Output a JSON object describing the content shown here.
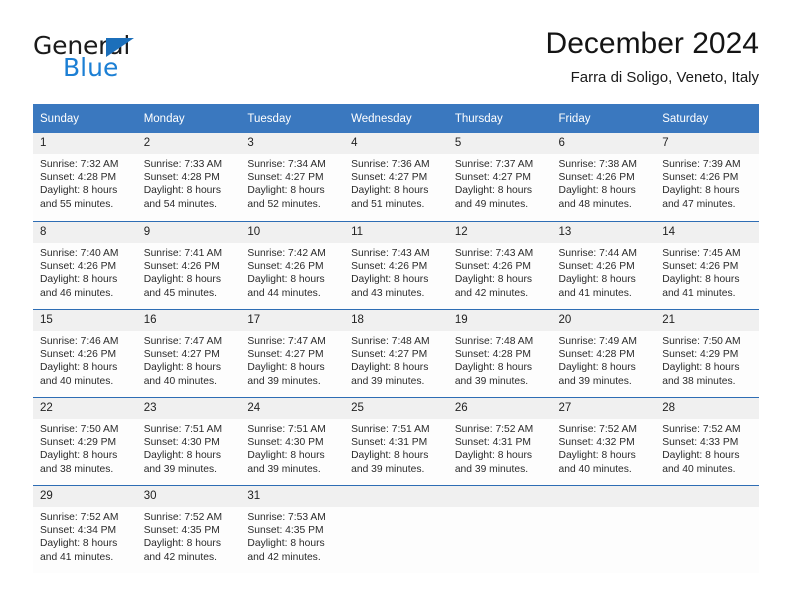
{
  "brand": {
    "line1": "General",
    "line2": "Blue",
    "accent_color": "#1c7fd4",
    "triangle_color": "#1c6fba"
  },
  "header": {
    "title": "December 2024",
    "subtitle": "Farra di Soligo, Veneto, Italy"
  },
  "calendar": {
    "header_color": "#3a78bf",
    "weekdays": [
      "Sunday",
      "Monday",
      "Tuesday",
      "Wednesday",
      "Thursday",
      "Friday",
      "Saturday"
    ],
    "weeks": [
      [
        {
          "day": "1",
          "sunrise": "Sunrise: 7:32 AM",
          "sunset": "Sunset: 4:28 PM",
          "daylight1": "Daylight: 8 hours",
          "daylight2": "and 55 minutes."
        },
        {
          "day": "2",
          "sunrise": "Sunrise: 7:33 AM",
          "sunset": "Sunset: 4:28 PM",
          "daylight1": "Daylight: 8 hours",
          "daylight2": "and 54 minutes."
        },
        {
          "day": "3",
          "sunrise": "Sunrise: 7:34 AM",
          "sunset": "Sunset: 4:27 PM",
          "daylight1": "Daylight: 8 hours",
          "daylight2": "and 52 minutes."
        },
        {
          "day": "4",
          "sunrise": "Sunrise: 7:36 AM",
          "sunset": "Sunset: 4:27 PM",
          "daylight1": "Daylight: 8 hours",
          "daylight2": "and 51 minutes."
        },
        {
          "day": "5",
          "sunrise": "Sunrise: 7:37 AM",
          "sunset": "Sunset: 4:27 PM",
          "daylight1": "Daylight: 8 hours",
          "daylight2": "and 49 minutes."
        },
        {
          "day": "6",
          "sunrise": "Sunrise: 7:38 AM",
          "sunset": "Sunset: 4:26 PM",
          "daylight1": "Daylight: 8 hours",
          "daylight2": "and 48 minutes."
        },
        {
          "day": "7",
          "sunrise": "Sunrise: 7:39 AM",
          "sunset": "Sunset: 4:26 PM",
          "daylight1": "Daylight: 8 hours",
          "daylight2": "and 47 minutes."
        }
      ],
      [
        {
          "day": "8",
          "sunrise": "Sunrise: 7:40 AM",
          "sunset": "Sunset: 4:26 PM",
          "daylight1": "Daylight: 8 hours",
          "daylight2": "and 46 minutes."
        },
        {
          "day": "9",
          "sunrise": "Sunrise: 7:41 AM",
          "sunset": "Sunset: 4:26 PM",
          "daylight1": "Daylight: 8 hours",
          "daylight2": "and 45 minutes."
        },
        {
          "day": "10",
          "sunrise": "Sunrise: 7:42 AM",
          "sunset": "Sunset: 4:26 PM",
          "daylight1": "Daylight: 8 hours",
          "daylight2": "and 44 minutes."
        },
        {
          "day": "11",
          "sunrise": "Sunrise: 7:43 AM",
          "sunset": "Sunset: 4:26 PM",
          "daylight1": "Daylight: 8 hours",
          "daylight2": "and 43 minutes."
        },
        {
          "day": "12",
          "sunrise": "Sunrise: 7:43 AM",
          "sunset": "Sunset: 4:26 PM",
          "daylight1": "Daylight: 8 hours",
          "daylight2": "and 42 minutes."
        },
        {
          "day": "13",
          "sunrise": "Sunrise: 7:44 AM",
          "sunset": "Sunset: 4:26 PM",
          "daylight1": "Daylight: 8 hours",
          "daylight2": "and 41 minutes."
        },
        {
          "day": "14",
          "sunrise": "Sunrise: 7:45 AM",
          "sunset": "Sunset: 4:26 PM",
          "daylight1": "Daylight: 8 hours",
          "daylight2": "and 41 minutes."
        }
      ],
      [
        {
          "day": "15",
          "sunrise": "Sunrise: 7:46 AM",
          "sunset": "Sunset: 4:26 PM",
          "daylight1": "Daylight: 8 hours",
          "daylight2": "and 40 minutes."
        },
        {
          "day": "16",
          "sunrise": "Sunrise: 7:47 AM",
          "sunset": "Sunset: 4:27 PM",
          "daylight1": "Daylight: 8 hours",
          "daylight2": "and 40 minutes."
        },
        {
          "day": "17",
          "sunrise": "Sunrise: 7:47 AM",
          "sunset": "Sunset: 4:27 PM",
          "daylight1": "Daylight: 8 hours",
          "daylight2": "and 39 minutes."
        },
        {
          "day": "18",
          "sunrise": "Sunrise: 7:48 AM",
          "sunset": "Sunset: 4:27 PM",
          "daylight1": "Daylight: 8 hours",
          "daylight2": "and 39 minutes."
        },
        {
          "day": "19",
          "sunrise": "Sunrise: 7:48 AM",
          "sunset": "Sunset: 4:28 PM",
          "daylight1": "Daylight: 8 hours",
          "daylight2": "and 39 minutes."
        },
        {
          "day": "20",
          "sunrise": "Sunrise: 7:49 AM",
          "sunset": "Sunset: 4:28 PM",
          "daylight1": "Daylight: 8 hours",
          "daylight2": "and 39 minutes."
        },
        {
          "day": "21",
          "sunrise": "Sunrise: 7:50 AM",
          "sunset": "Sunset: 4:29 PM",
          "daylight1": "Daylight: 8 hours",
          "daylight2": "and 38 minutes."
        }
      ],
      [
        {
          "day": "22",
          "sunrise": "Sunrise: 7:50 AM",
          "sunset": "Sunset: 4:29 PM",
          "daylight1": "Daylight: 8 hours",
          "daylight2": "and 38 minutes."
        },
        {
          "day": "23",
          "sunrise": "Sunrise: 7:51 AM",
          "sunset": "Sunset: 4:30 PM",
          "daylight1": "Daylight: 8 hours",
          "daylight2": "and 39 minutes."
        },
        {
          "day": "24",
          "sunrise": "Sunrise: 7:51 AM",
          "sunset": "Sunset: 4:30 PM",
          "daylight1": "Daylight: 8 hours",
          "daylight2": "and 39 minutes."
        },
        {
          "day": "25",
          "sunrise": "Sunrise: 7:51 AM",
          "sunset": "Sunset: 4:31 PM",
          "daylight1": "Daylight: 8 hours",
          "daylight2": "and 39 minutes."
        },
        {
          "day": "26",
          "sunrise": "Sunrise: 7:52 AM",
          "sunset": "Sunset: 4:31 PM",
          "daylight1": "Daylight: 8 hours",
          "daylight2": "and 39 minutes."
        },
        {
          "day": "27",
          "sunrise": "Sunrise: 7:52 AM",
          "sunset": "Sunset: 4:32 PM",
          "daylight1": "Daylight: 8 hours",
          "daylight2": "and 40 minutes."
        },
        {
          "day": "28",
          "sunrise": "Sunrise: 7:52 AM",
          "sunset": "Sunset: 4:33 PM",
          "daylight1": "Daylight: 8 hours",
          "daylight2": "and 40 minutes."
        }
      ],
      [
        {
          "day": "29",
          "sunrise": "Sunrise: 7:52 AM",
          "sunset": "Sunset: 4:34 PM",
          "daylight1": "Daylight: 8 hours",
          "daylight2": "and 41 minutes."
        },
        {
          "day": "30",
          "sunrise": "Sunrise: 7:52 AM",
          "sunset": "Sunset: 4:35 PM",
          "daylight1": "Daylight: 8 hours",
          "daylight2": "and 42 minutes."
        },
        {
          "day": "31",
          "sunrise": "Sunrise: 7:53 AM",
          "sunset": "Sunset: 4:35 PM",
          "daylight1": "Daylight: 8 hours",
          "daylight2": "and 42 minutes."
        },
        {
          "day": "",
          "sunrise": "",
          "sunset": "",
          "daylight1": "",
          "daylight2": ""
        },
        {
          "day": "",
          "sunrise": "",
          "sunset": "",
          "daylight1": "",
          "daylight2": ""
        },
        {
          "day": "",
          "sunrise": "",
          "sunset": "",
          "daylight1": "",
          "daylight2": ""
        },
        {
          "day": "",
          "sunrise": "",
          "sunset": "",
          "daylight1": "",
          "daylight2": ""
        }
      ]
    ]
  }
}
